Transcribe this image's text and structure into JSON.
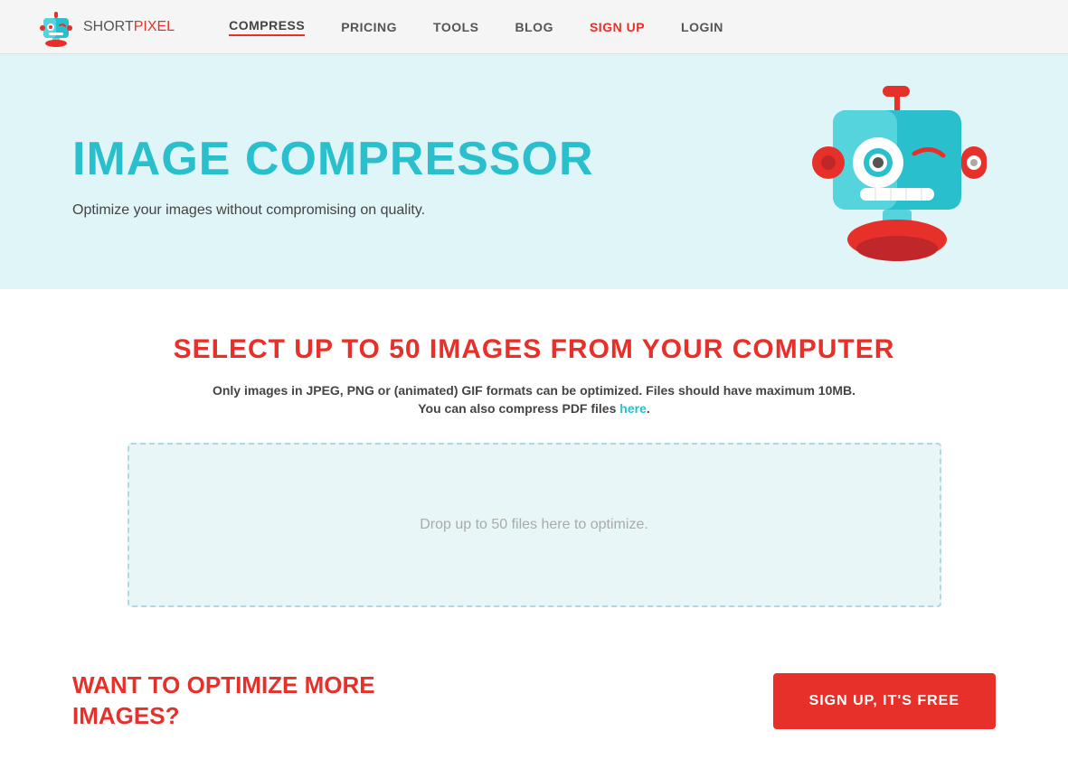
{
  "header": {
    "logo_short": "SHORT",
    "logo_pixel": "PIXEL",
    "nav": [
      {
        "label": "COMPRESS",
        "active": true,
        "class": "active"
      },
      {
        "label": "PRICING",
        "active": false,
        "class": ""
      },
      {
        "label": "TOOLS",
        "active": false,
        "class": ""
      },
      {
        "label": "BLOG",
        "active": false,
        "class": ""
      },
      {
        "label": "SIGN UP",
        "active": false,
        "class": "signup"
      },
      {
        "label": "LOGIN",
        "active": false,
        "class": "login"
      }
    ]
  },
  "hero": {
    "title": "IMAGE COMPRESSOR",
    "subtitle": "Optimize your images without compromising on quality."
  },
  "main": {
    "section_title": "SELECT UP TO 50 IMAGES FROM YOUR COMPUTER",
    "file_info_line1": "Only images in JPEG, PNG or (animated) GIF formats can be optimized. Files should have maximum 10MB.",
    "file_info_line2_prefix": "You can also compress PDF files ",
    "file_info_link": "here",
    "drop_zone_text": "Drop up to 50 files here to optimize."
  },
  "cta": {
    "title_line1": "WANT TO OPTIMIZE MORE",
    "title_line2": "IMAGES?",
    "button_label": "SIGN UP, IT'S FREE"
  },
  "colors": {
    "teal": "#2abfcc",
    "red": "#e8302a",
    "hero_bg": "#e0f5f8",
    "drop_bg": "#e8f6f8"
  }
}
